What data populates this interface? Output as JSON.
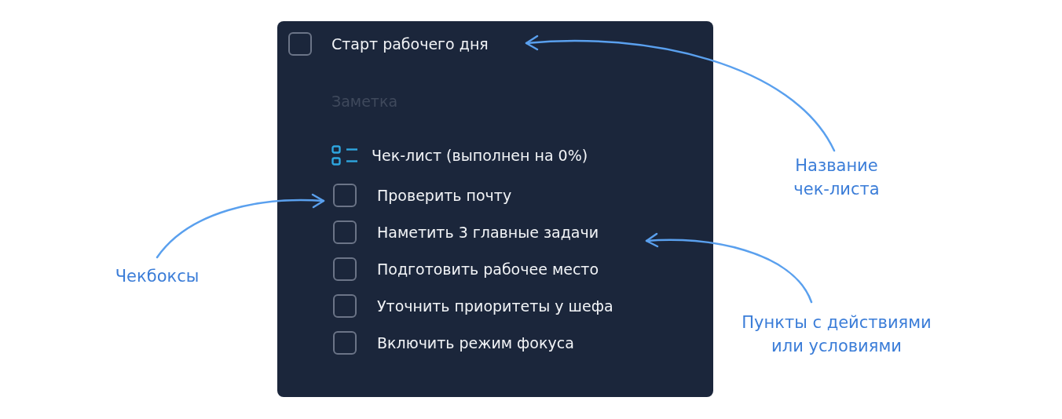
{
  "task": {
    "title": "Старт рабочего дня",
    "checked": false
  },
  "note": {
    "placeholder": "Заметка"
  },
  "checklist": {
    "title": "Чек-лист (выполнен на 0%)",
    "items": [
      {
        "label": "Проверить почту",
        "checked": false
      },
      {
        "label": "Наметить 3 главные задачи",
        "checked": false
      },
      {
        "label": "Подготовить рабочее место",
        "checked": false
      },
      {
        "label": "Уточнить приоритеты у шефа",
        "checked": false
      },
      {
        "label": "Включить режим фокуса",
        "checked": false
      }
    ]
  },
  "annotations": [
    {
      "text": "Название\nчек-листа"
    },
    {
      "text": "Чекбоксы"
    },
    {
      "text": "Пункты с действиями\nили условиями"
    }
  ]
}
